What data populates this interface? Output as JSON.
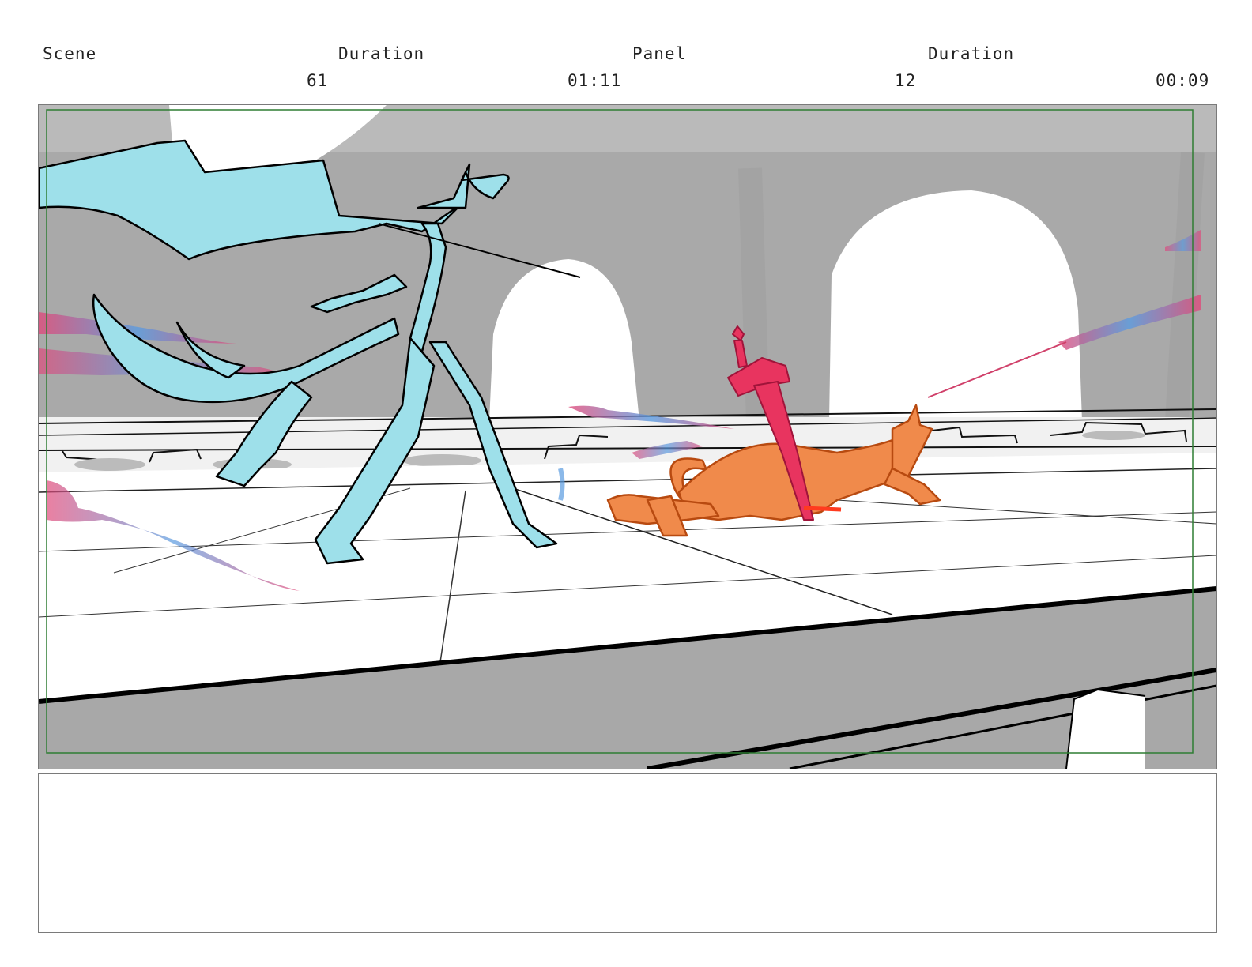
{
  "header": {
    "scene_label": "Scene",
    "scene_duration_label": "Duration",
    "panel_label": "Panel",
    "panel_duration_label": "Duration",
    "scene_value": "61",
    "scene_duration_value": "01:11",
    "panel_value": "12",
    "panel_duration_value": "00:09"
  },
  "panel": {
    "safe_frame_color": "#2e7d32",
    "character_left_color": "#9ee0ea",
    "character_right_color": "#f08a4b",
    "sword_color": "#e8345f"
  },
  "notes": {
    "text": ""
  }
}
